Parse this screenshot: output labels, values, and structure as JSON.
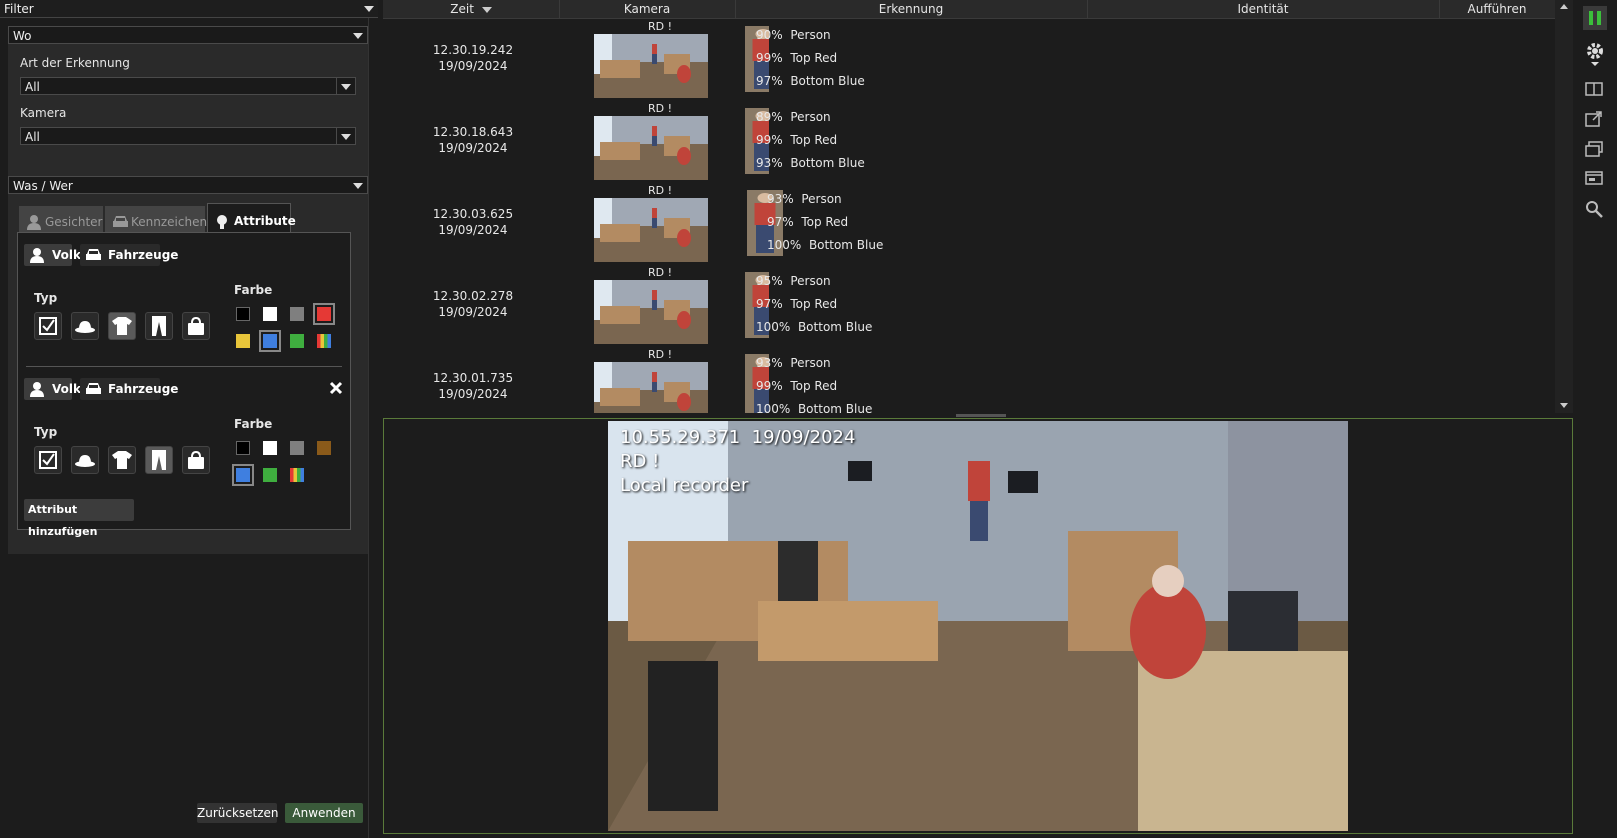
{
  "filter": {
    "title": "Filter"
  },
  "wo": {
    "title": "Wo",
    "art_label": "Art der Erkennung",
    "art_value": "All",
    "kamera_label": "Kamera",
    "kamera_value": "All"
  },
  "was": {
    "title": "Was / Wer"
  },
  "tabs": [
    {
      "label": "Gesichter",
      "icon": "person-icon"
    },
    {
      "label": "Kennzeichen",
      "icon": "car-icon"
    },
    {
      "label": "Attribute",
      "icon": "lightbulb-icon"
    }
  ],
  "attr_groups": [
    {
      "volk": "Volk",
      "fahrzeuge": "Fahrzeuge",
      "typ": "Typ",
      "farbe": "Farbe",
      "colors": [
        "#000000",
        "#ffffff",
        "#7f7f7f",
        "#e53935",
        "#e8c53a",
        "#3f7fe0",
        "#3fae3f",
        "multi"
      ]
    },
    {
      "volk": "Volk",
      "fahrzeuge": "Fahrzeuge",
      "typ": "Typ",
      "farbe": "Farbe",
      "colors": [
        "#000000",
        "#ffffff",
        "#7f7f7f",
        "#8a5a1a",
        "#3f7fe0",
        "#3fae3f",
        "multi"
      ]
    }
  ],
  "add_attr": "Attribut hinzufügen",
  "reset_label": "Zurücksetzen",
  "apply_label": "Anwenden",
  "columns": [
    "Zeit",
    "Kamera",
    "Erkennung",
    "Identität",
    "Aufführen"
  ],
  "results": [
    {
      "time": "12.30.19.242",
      "date": "19/09/2024",
      "rd": "RD !",
      "det": [
        [
          "90%",
          "Person"
        ],
        [
          "99%",
          "Top Red"
        ],
        [
          "97%",
          "Bottom Blue"
        ]
      ]
    },
    {
      "time": "12.30.18.643",
      "date": "19/09/2024",
      "rd": "RD !",
      "det": [
        [
          "89%",
          "Person"
        ],
        [
          "99%",
          "Top Red"
        ],
        [
          "93%",
          "Bottom Blue"
        ]
      ]
    },
    {
      "time": "12.30.03.625",
      "date": "19/09/2024",
      "rd": "RD !",
      "det": [
        [
          "93%",
          "Person"
        ],
        [
          "97%",
          "Top Red"
        ],
        [
          "100%",
          "Bottom Blue"
        ]
      ]
    },
    {
      "time": "12.30.02.278",
      "date": "19/09/2024",
      "rd": "RD !",
      "det": [
        [
          "95%",
          "Person"
        ],
        [
          "97%",
          "Top Red"
        ],
        [
          "100%",
          "Bottom Blue"
        ]
      ]
    },
    {
      "time": "12.30.01.735",
      "date": "19/09/2024",
      "rd": "RD !",
      "det": [
        [
          "93%",
          "Person"
        ],
        [
          "99%",
          "Top Red"
        ],
        [
          "100%",
          "Bottom Blue"
        ]
      ]
    }
  ],
  "video": {
    "timestamp": "10.55.29.371  19/09/2024",
    "rd": "RD !",
    "source": "Local recorder"
  },
  "side_icons": [
    "pause-icon",
    "gear-icon",
    "layout-icon",
    "export-icon",
    "archive-icon",
    "window-icon",
    "search-icon"
  ]
}
